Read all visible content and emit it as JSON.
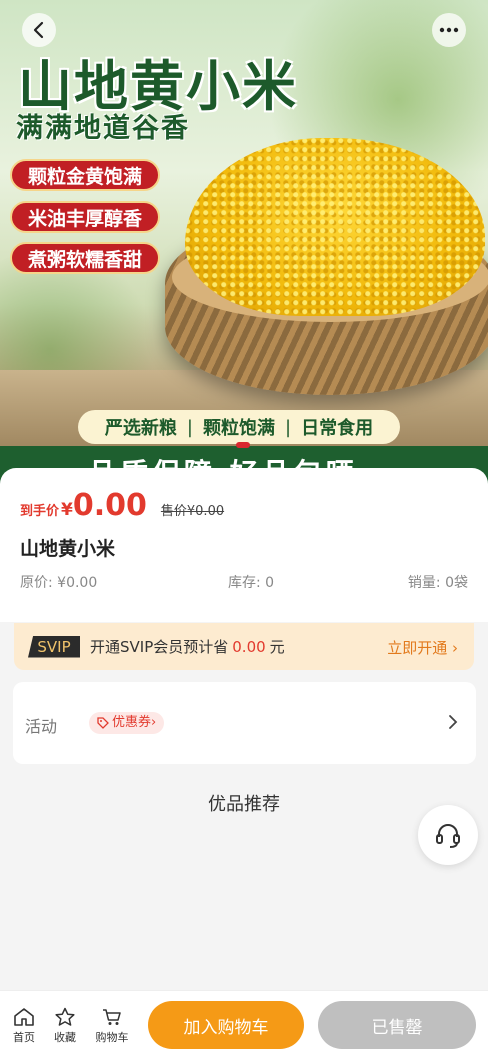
{
  "hero": {
    "title": "山地黄小米",
    "subtitle": "满满地道谷香",
    "tags": [
      "颗粒金黄饱满",
      "米油丰厚醇香",
      "煮粥软糯香甜"
    ],
    "features": [
      "严选新粮",
      "颗粒饱满",
      "日常食用"
    ],
    "separator": "|",
    "bottom_text": "品质保障    好品包晒"
  },
  "product": {
    "price_label": "到手价",
    "currency": "¥",
    "price": "0.00",
    "sale_price": "售价¥0.00",
    "name": "山地黄小米",
    "original_price": "原价: ¥0.00",
    "stock": "库存: 0",
    "sales": "销量: 0袋"
  },
  "svip": {
    "badge": "SVIP",
    "text_prefix": "开通SVIP会员预计省",
    "amount": "0.00",
    "unit": "元",
    "open_label": "立即开通 ›"
  },
  "activity": {
    "label": "活动",
    "coupon": "优惠券›"
  },
  "recommend": "优品推荐",
  "bottom_nav": {
    "home": "首页",
    "favorite": "收藏",
    "cart": "购物车",
    "add_to_cart": "加入购物车",
    "sold_out": "已售罄"
  },
  "colors": {
    "accent_red": "#e23a2e",
    "brand_green": "#1d5a2b",
    "cart_orange": "#f59a16",
    "disabled_gray": "#bfbfbf"
  }
}
